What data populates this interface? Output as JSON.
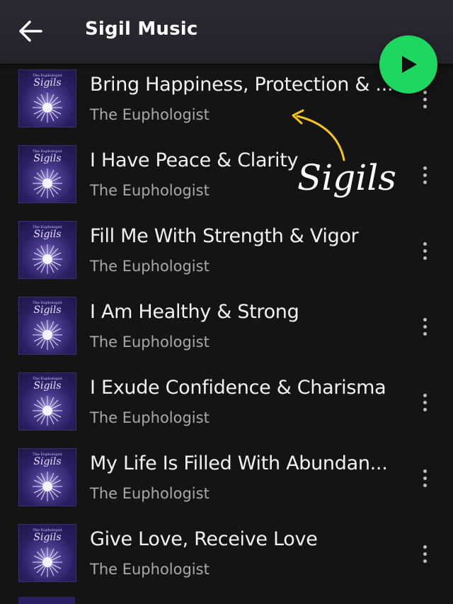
{
  "header": {
    "title": "Sigil Music",
    "back_icon": "arrow-left-icon",
    "play_icon": "play-icon",
    "play_color": "#1ed760"
  },
  "cover": {
    "top_text": "The Euphologist",
    "name": "Sigils"
  },
  "tracks": [
    {
      "title": "Bring Happiness, Protection & ...",
      "artist": "The Euphologist"
    },
    {
      "title": "I Have Peace & Clarity",
      "artist": "The Euphologist"
    },
    {
      "title": "Fill Me With Strength & Vigor",
      "artist": "The Euphologist"
    },
    {
      "title": "I Am Healthy & Strong",
      "artist": "The Euphologist"
    },
    {
      "title": "I Exude Confidence & Charisma",
      "artist": "The Euphologist"
    },
    {
      "title": "My Life Is Filled With Abundan...",
      "artist": "The Euphologist"
    },
    {
      "title": "Give Love, Receive Love",
      "artist": "The Euphologist"
    }
  ],
  "annotation": {
    "text": "Sigils",
    "color": "#f5c518"
  }
}
